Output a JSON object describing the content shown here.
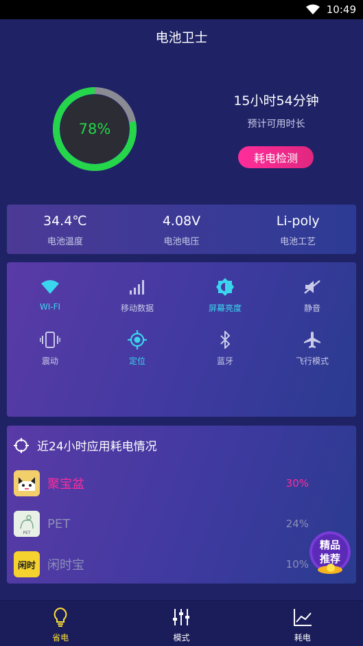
{
  "status_bar": {
    "time": "10:49"
  },
  "page_title": "电池卫士",
  "battery": {
    "percent_text": "78%",
    "percent": 78,
    "remaining_time": "15小时54分钟",
    "remaining_label": "预计可用时长",
    "detect_button": "耗电检测"
  },
  "stats": [
    {
      "value": "34.4℃",
      "label": "电池温度"
    },
    {
      "value": "4.08V",
      "label": "电池电压"
    },
    {
      "value": "Li-poly",
      "label": "电池工艺"
    }
  ],
  "toggles": [
    {
      "label": "WI-FI",
      "icon": "wifi-icon",
      "on": true
    },
    {
      "label": "移动数据",
      "icon": "signal-icon",
      "on": false
    },
    {
      "label": "屏幕亮度",
      "icon": "brightness-icon",
      "on": true
    },
    {
      "label": "静音",
      "icon": "mute-icon",
      "on": false
    },
    {
      "label": "震动",
      "icon": "vibrate-icon",
      "on": false
    },
    {
      "label": "定位",
      "icon": "location-icon",
      "on": true
    },
    {
      "label": "蓝牙",
      "icon": "bluetooth-icon",
      "on": false
    },
    {
      "label": "飞行模式",
      "icon": "airplane-icon",
      "on": false
    }
  ],
  "usage": {
    "title": "近24小时应用耗电情况",
    "apps": [
      {
        "name": "聚宝盆",
        "percent": "30%"
      },
      {
        "name": "PET",
        "percent": "24%"
      },
      {
        "name": "闲时宝",
        "percent": "10%"
      }
    ],
    "icon_text": {
      "app3_main": "闲时",
      "app2_sub": "PET"
    }
  },
  "badge": {
    "line1": "精品",
    "line2": "推荐"
  },
  "bottom_nav": [
    {
      "label": "省电",
      "icon": "bulb-icon",
      "active": true
    },
    {
      "label": "模式",
      "icon": "sliders-icon",
      "active": false
    },
    {
      "label": "耗电",
      "icon": "chart-icon",
      "active": false
    }
  ],
  "colors": {
    "background": "#1f2366",
    "accent_green": "#25d64a",
    "accent_pink": "#ff2d9a",
    "accent_cyan": "#3ad6ee",
    "nav_active": "#ffe135"
  }
}
